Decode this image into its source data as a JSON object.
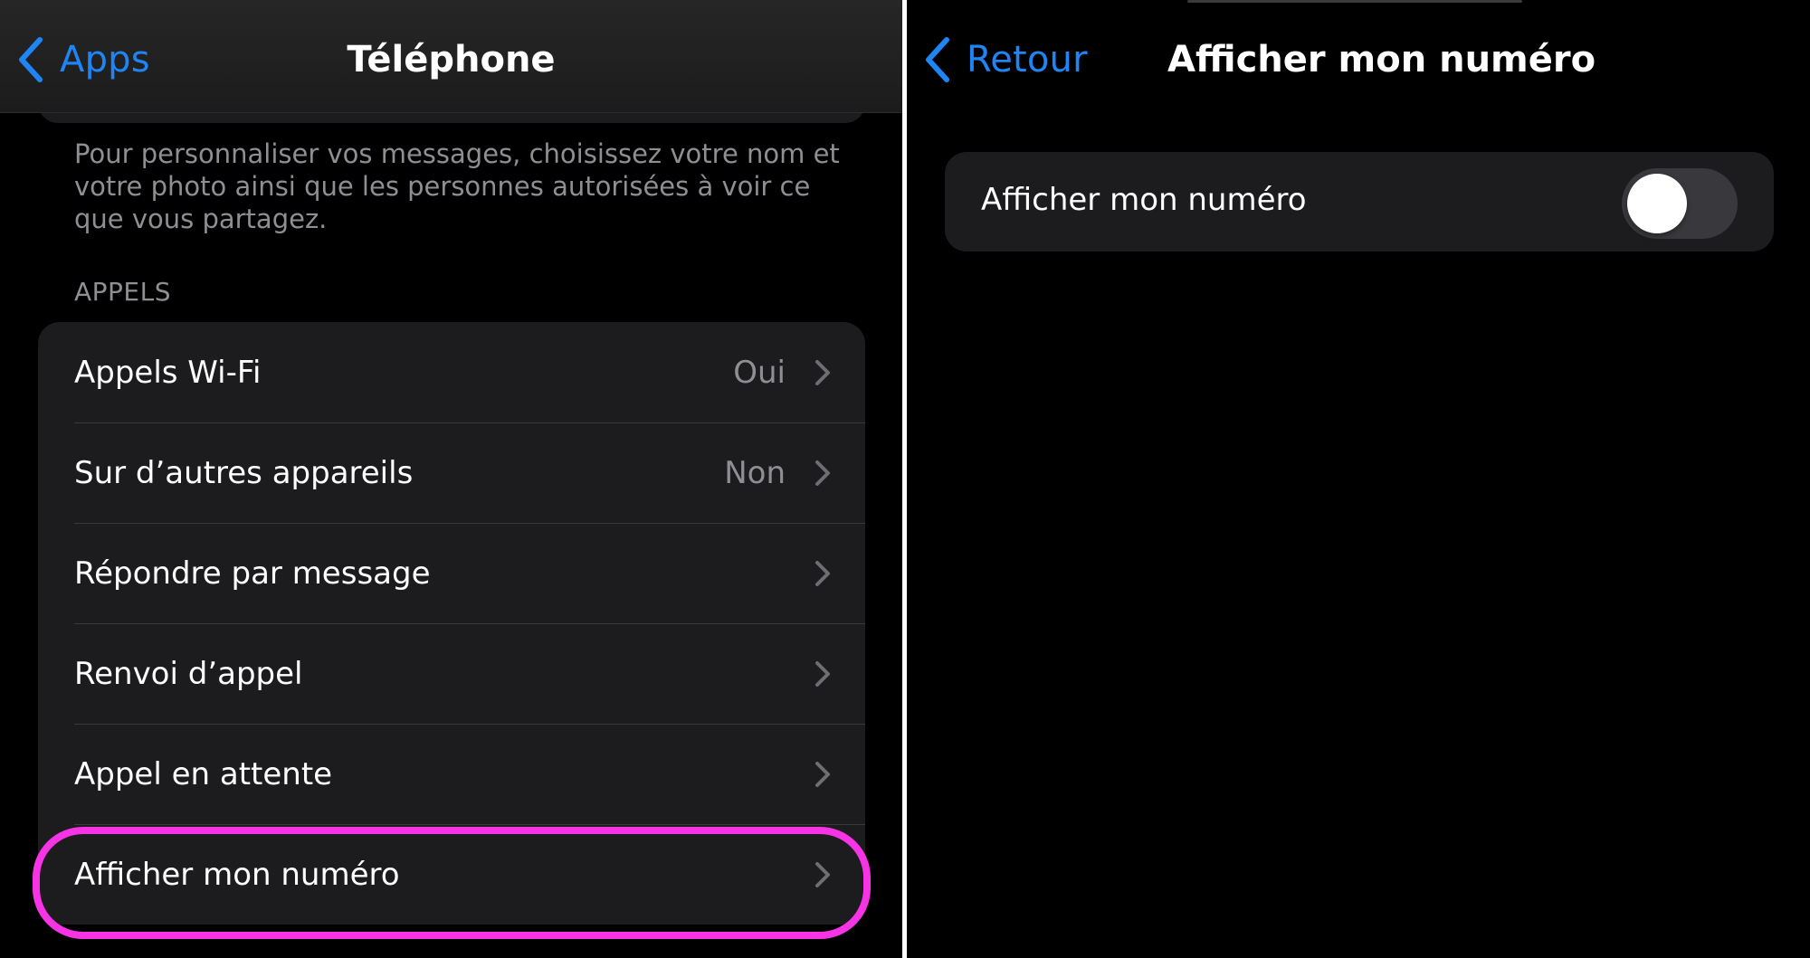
{
  "left": {
    "back_label": "Apps",
    "title": "Téléphone",
    "footer_text": "Pour personnaliser vos messages, choisissez votre nom et votre photo ainsi que les personnes autorisées à voir ce que vous partagez.",
    "section_header": "APPELS",
    "rows": [
      {
        "label": "Appels Wi-Fi",
        "value": "Oui"
      },
      {
        "label": "Sur d’autres appareils",
        "value": "Non"
      },
      {
        "label": "Répondre par message",
        "value": ""
      },
      {
        "label": "Renvoi d’appel",
        "value": ""
      },
      {
        "label": "Appel en attente",
        "value": ""
      },
      {
        "label": "Afficher mon numéro",
        "value": ""
      }
    ],
    "highlighted_row": "Afficher mon numéro"
  },
  "right": {
    "back_label": "Retour",
    "title": "Afficher mon numéro",
    "toggle": {
      "label": "Afficher mon numéro",
      "on": false
    }
  },
  "colors": {
    "accent": "#1f85f5",
    "highlight": "#f634e6",
    "background": "#000000",
    "card": "#1c1c1e",
    "secondary_text": "#8e8e93"
  },
  "icons": {
    "back": "chevron-left-icon",
    "disclosure": "chevron-right-icon"
  }
}
